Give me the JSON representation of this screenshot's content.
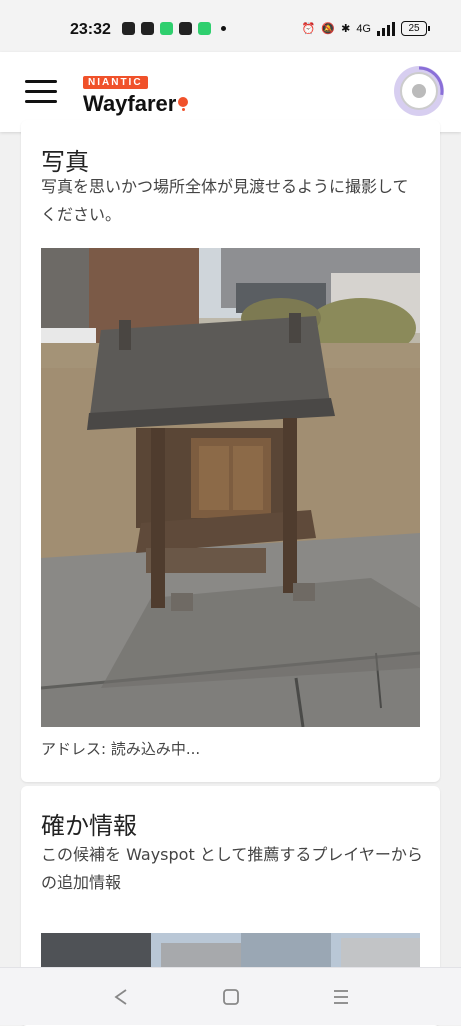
{
  "status_bar": {
    "time": "23:32",
    "network": "4G",
    "battery": "25"
  },
  "header": {
    "brand_top": "NIANTIC",
    "brand_name": "Wayfarer"
  },
  "photo_section": {
    "title": "写真",
    "description": "写真を思いかつ場所全体が見渡せるように撮影してください。",
    "address": "アドレス: 読み込み中..."
  },
  "info_section": {
    "title": "確か情報",
    "description": "この候補を Wayspot として推薦するプレイヤーからの追加情報"
  },
  "colors": {
    "brand_orange": "#f0512a",
    "avatar_ring": "#d7cef0",
    "background": "#f1f1f1"
  },
  "icons": [
    "menu-icon",
    "back-icon",
    "home-icon",
    "recents-icon"
  ]
}
